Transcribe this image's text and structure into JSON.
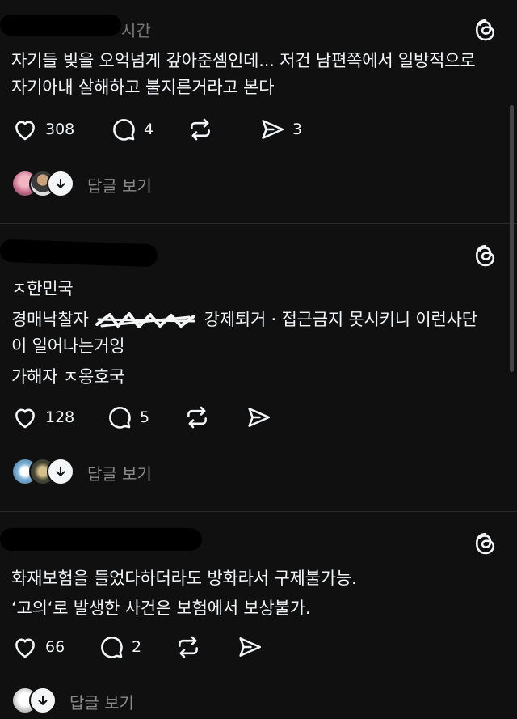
{
  "posts": [
    {
      "time": "시간",
      "lines": [
        "자기들 빚을 오억넘게 갚아준셈인데... 저건 남편쪽에서 일방적으로",
        "자기아내 살해하고 불지른거라고 본다"
      ],
      "likes": "308",
      "comments": "4",
      "shares": "3",
      "reply_label": "답글 보기"
    },
    {
      "time": "",
      "lines": [
        "ㅈ한민국",
        "이 일어나는거잉",
        "가해자 ㅈ옹호국"
      ],
      "line2_prefix": "경매낙찰자",
      "line2_suffix": "강제퇴거 · 접근금지 못시키니 이런사단",
      "likes": "128",
      "comments": "5",
      "shares": "",
      "reply_label": "답글 보기"
    },
    {
      "time": "",
      "lines": [
        "화재보험을 들었다하더라도 방화라서 구제불가능.",
        "‘고의‘로 발생한 사건은 보험에서 보상불가."
      ],
      "likes": "66",
      "comments": "2",
      "shares": "",
      "reply_label": "답글 보기"
    }
  ],
  "icons": {
    "threads": "threads-logo-icon",
    "like": "heart-icon",
    "comment": "comment-bubble-icon",
    "repost": "repost-icon",
    "share": "send-icon",
    "avatar_more": "arrow-down-icon"
  }
}
